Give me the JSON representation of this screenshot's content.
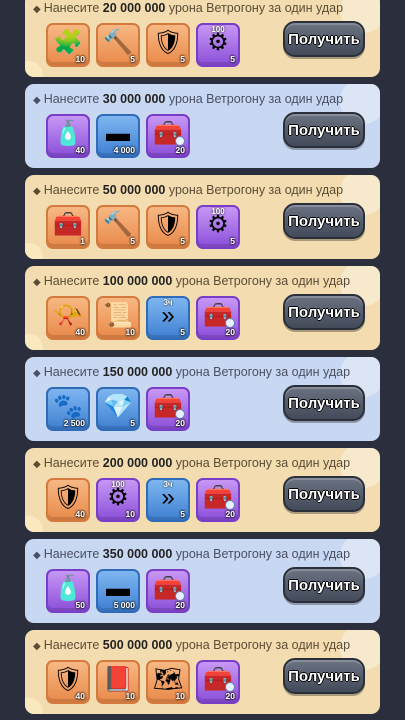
{
  "rewards": [
    {
      "theme": "gold",
      "prefix": "Нанесите",
      "amount": "20 000 000",
      "suffix": "урона Ветрогону за один удар",
      "button": "Получить",
      "items": [
        {
          "color": "orange",
          "icon": "puzzle-piece-icon",
          "glyph": "🧩",
          "count": "10",
          "top": ""
        },
        {
          "color": "orange",
          "icon": "crystal-hammer-icon",
          "glyph": "🔨",
          "count": "5",
          "top": ""
        },
        {
          "color": "orange",
          "icon": "hero-fragment-icon",
          "glyph": "🛡",
          "count": "5",
          "top": ""
        },
        {
          "color": "purple",
          "icon": "gear-nut-icon",
          "glyph": "⚙",
          "count": "5",
          "top": "100"
        }
      ]
    },
    {
      "theme": "blue",
      "prefix": "Нанесите",
      "amount": "30 000 000",
      "suffix": "урона Ветрогону за один удар",
      "button": "Получить",
      "items": [
        {
          "color": "purple",
          "icon": "potion-bottle-icon",
          "glyph": "🧴",
          "count": "40",
          "top": ""
        },
        {
          "color": "blue",
          "icon": "iron-ingot-icon",
          "glyph": "▬",
          "count": "4 000",
          "top": ""
        },
        {
          "color": "purple",
          "icon": "treasure-chest-icon",
          "glyph": "🧰",
          "count": "20",
          "top": ""
        }
      ]
    },
    {
      "theme": "gold",
      "prefix": "Нанесите",
      "amount": "50 000 000",
      "suffix": "урона Ветрогону за один удар",
      "button": "Получить",
      "items": [
        {
          "color": "orange",
          "icon": "treasure-chest-icon",
          "glyph": "🧰",
          "count": "1",
          "top": ""
        },
        {
          "color": "orange",
          "icon": "crystal-hammer-icon",
          "glyph": "🔨",
          "count": "5",
          "top": ""
        },
        {
          "color": "orange",
          "icon": "hero-fragment-icon",
          "glyph": "🛡",
          "count": "5",
          "top": ""
        },
        {
          "color": "purple",
          "icon": "gear-nut-icon",
          "glyph": "⚙",
          "count": "5",
          "top": "100"
        }
      ]
    },
    {
      "theme": "gold",
      "prefix": "Нанесите",
      "amount": "100 000 000",
      "suffix": "урона Ветрогону за один удар",
      "button": "Получить",
      "items": [
        {
          "color": "orange",
          "icon": "golden-horn-icon",
          "glyph": "📯",
          "count": "40",
          "top": ""
        },
        {
          "color": "orange",
          "icon": "scroll-icon",
          "glyph": "📜",
          "count": "10",
          "top": ""
        },
        {
          "color": "blue",
          "icon": "speed-arrows-icon",
          "glyph": "»",
          "count": "5",
          "top": "3ч"
        },
        {
          "color": "purple",
          "icon": "treasure-chest-icon",
          "glyph": "🧰",
          "count": "20",
          "top": ""
        }
      ]
    },
    {
      "theme": "blue",
      "prefix": "Нанесите",
      "amount": "150 000 000",
      "suffix": "урона Ветрогону за один удар",
      "button": "Получить",
      "items": [
        {
          "color": "blue",
          "icon": "paw-bag-icon",
          "glyph": "🐾",
          "count": "2 500",
          "top": ""
        },
        {
          "color": "blue",
          "icon": "gray-gem-icon",
          "glyph": "💎",
          "count": "5",
          "top": ""
        },
        {
          "color": "purple",
          "icon": "treasure-chest-icon",
          "glyph": "🧰",
          "count": "20",
          "top": ""
        }
      ]
    },
    {
      "theme": "gold",
      "prefix": "Нанесите",
      "amount": "200 000 000",
      "suffix": "урона Ветрогону за один удар",
      "button": "Получить",
      "items": [
        {
          "color": "orange",
          "icon": "hero-fragment-icon",
          "glyph": "🛡",
          "count": "40",
          "top": ""
        },
        {
          "color": "purple",
          "icon": "gear-nut-icon",
          "glyph": "⚙",
          "count": "10",
          "top": "100"
        },
        {
          "color": "blue",
          "icon": "speed-arrows-icon",
          "glyph": "»",
          "count": "5",
          "top": "3ч"
        },
        {
          "color": "purple",
          "icon": "treasure-chest-icon",
          "glyph": "🧰",
          "count": "20",
          "top": ""
        }
      ]
    },
    {
      "theme": "blue",
      "prefix": "Нанесите",
      "amount": "350 000 000",
      "suffix": "урона Ветрогону за один удар",
      "button": "Получить",
      "items": [
        {
          "color": "purple",
          "icon": "potion-bottle-icon",
          "glyph": "🧴",
          "count": "50",
          "top": ""
        },
        {
          "color": "blue",
          "icon": "iron-ingot-icon",
          "glyph": "▬",
          "count": "5 000",
          "top": ""
        },
        {
          "color": "purple",
          "icon": "treasure-chest-icon",
          "glyph": "🧰",
          "count": "20",
          "top": ""
        }
      ]
    },
    {
      "theme": "gold",
      "prefix": "Нанесите",
      "amount": "500 000 000",
      "suffix": "урона Ветрогону за один удар",
      "button": "Получить",
      "items": [
        {
          "color": "orange",
          "icon": "hero-fragment-icon",
          "glyph": "🛡",
          "count": "40",
          "top": ""
        },
        {
          "color": "orange",
          "icon": "book-icon",
          "glyph": "📕",
          "count": "10",
          "top": ""
        },
        {
          "color": "orange",
          "icon": "map-scroll-icon",
          "glyph": "🗺",
          "count": "10",
          "top": ""
        },
        {
          "color": "purple",
          "icon": "treasure-chest-icon",
          "glyph": "🧰",
          "count": "20",
          "top": ""
        }
      ]
    }
  ]
}
